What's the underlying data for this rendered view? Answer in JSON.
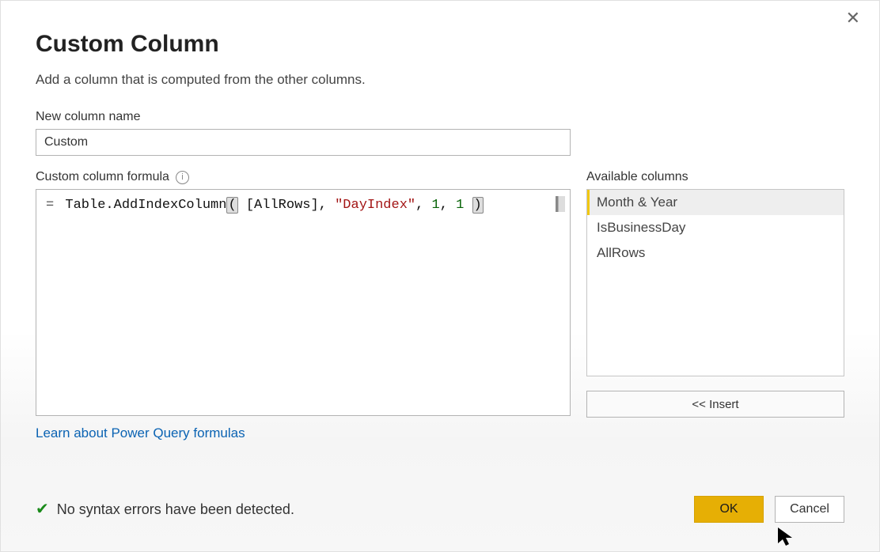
{
  "dialog": {
    "title": "Custom Column",
    "subtitle": "Add a column that is computed from the other columns."
  },
  "column_name": {
    "label": "New column name",
    "value": "Custom"
  },
  "formula": {
    "label": "Custom column formula",
    "tokens": {
      "eq": "=",
      "fn": "Table.AddIndexColumn",
      "open": "(",
      "arg_col": "[AllRows]",
      "comma1": ", ",
      "arg_str": "\"DayIndex\"",
      "comma2": ", ",
      "arg_n1": "1",
      "comma3": ", ",
      "arg_n2": "1",
      "space": " ",
      "close": ")"
    }
  },
  "available": {
    "label": "Available columns",
    "items": [
      {
        "label": "Month & Year",
        "selected": true
      },
      {
        "label": "IsBusinessDay",
        "selected": false
      },
      {
        "label": "AllRows",
        "selected": false
      }
    ],
    "insert_label": "<< Insert"
  },
  "learn_link": "Learn about Power Query formulas",
  "status": {
    "text": "No syntax errors have been detected."
  },
  "buttons": {
    "ok": "OK",
    "cancel": "Cancel"
  }
}
